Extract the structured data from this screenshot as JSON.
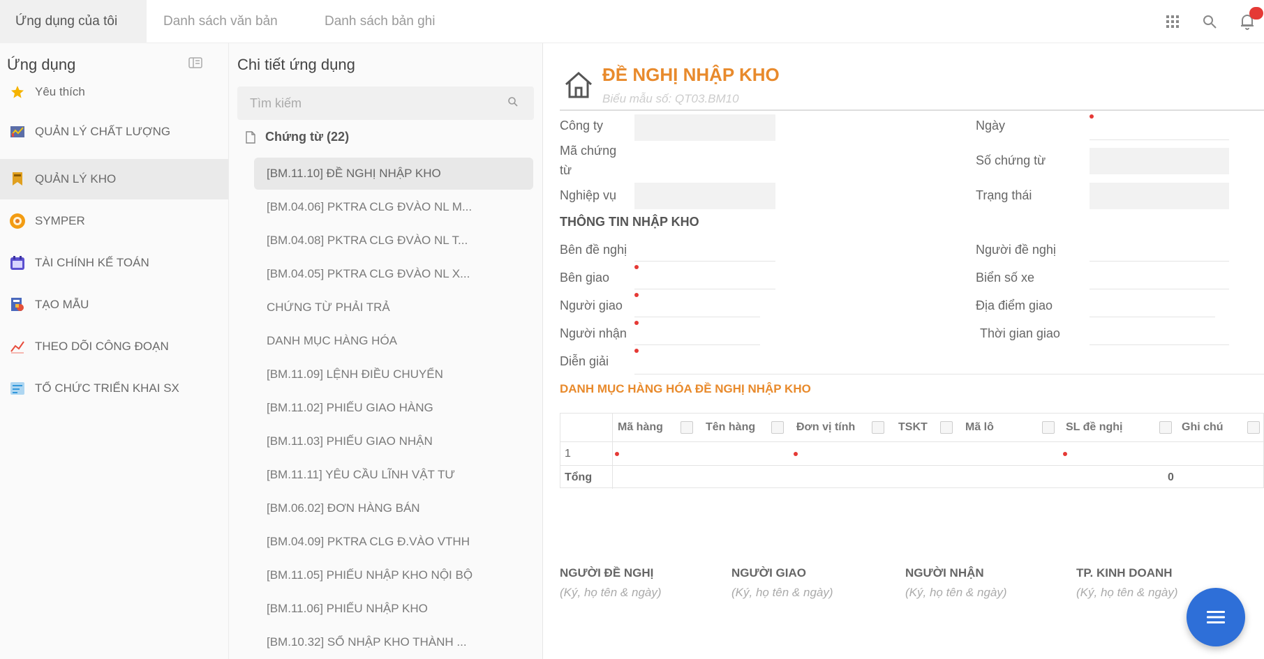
{
  "topbar": {
    "tabs": [
      {
        "label": "Ứng dụng của tôi",
        "active": true
      },
      {
        "label": "Danh sách văn bản",
        "active": false
      },
      {
        "label": "Danh sách bản ghi",
        "active": false
      }
    ],
    "icons": [
      "apps-grid-icon",
      "search-icon",
      "bell-icon"
    ]
  },
  "sidebar": {
    "title": "Ứng dụng",
    "items": [
      {
        "label": "Yêu thích",
        "icon": "star-icon",
        "color": "#f5b301"
      },
      {
        "label": "QUẢN LÝ CHẤT LƯỢNG",
        "icon": "chart-icon",
        "color": "#c0392b"
      },
      {
        "label": "QUẢN LÝ KHO",
        "icon": "warehouse-icon",
        "color": "#e0a020",
        "active": true
      },
      {
        "label": "SYMPER",
        "icon": "symper-icon",
        "color": "#f39c12"
      },
      {
        "label": "TÀI CHÍNH KẾ TOÁN",
        "icon": "calendar-icon",
        "color": "#5a4fcf"
      },
      {
        "label": "TẠO MẪU",
        "icon": "template-icon",
        "color": "#8e44ad"
      },
      {
        "label": "THEO DÕI CÔNG ĐOẠN",
        "icon": "line-chart-icon",
        "color": "#e74c3c"
      },
      {
        "label": "TỔ CHỨC TRIỂN KHAI SX",
        "icon": "tasks-icon",
        "color": "#3498db"
      }
    ]
  },
  "middle": {
    "title": "Chi tiết ứng dụng",
    "search_placeholder": "Tìm kiếm",
    "folder_label": "Chứng từ (22)",
    "items": [
      "[BM.11.10] ĐỀ NGHỊ NHẬP KHO",
      "[BM.04.06] PKTRA CLG ĐVÀO NL M...",
      "[BM.04.08] PKTRA CLG ĐVÀO NL T...",
      "[BM.04.05] PKTRA CLG ĐVÀO NL X...",
      "CHỨNG TỪ PHẢI TRẢ",
      "DANH MỤC HÀNG HÓA",
      "[BM.11.09] LỆNH ĐIỀU CHUYỂN",
      "[BM.11.02] PHIẾU GIAO HÀNG",
      "[BM.11.03] PHIẾU GIAO NHẬN",
      "[BM.11.11] YÊU CẦU LĨNH VẬT TƯ",
      "[BM.06.02] ĐƠN HÀNG BÁN",
      "[BM.04.09] PKTRA CLG Đ.VÀO VTHH",
      "[BM.11.05] PHIẾU NHẬP KHO NỘI BỘ",
      "[BM.11.06] PHIẾU NHẬP KHO",
      "[BM.10.32] SỔ NHẬP KHO THÀNH ..."
    ]
  },
  "form": {
    "title": "ĐỀ NGHỊ NHẬP KHO",
    "subtitle": "Biểu mẫu số: QT03.BM10",
    "labels": {
      "cong_ty": "Công ty",
      "ma_chung_tu_1": "Mã chứng",
      "ma_chung_tu_2": "từ",
      "nghiep_vu": "Nghiệp vụ",
      "ngay": "Ngày",
      "so_chung_tu": "Số chứng từ",
      "trang_thai": "Trạng thái",
      "section_info": "THÔNG TIN  NHẬP KHO",
      "ben_de_nghi": "Bên đề nghị",
      "ben_giao": "Bên giao",
      "nguoi_giao": "Người giao",
      "nguoi_nhan": "Người nhận",
      "dien_giai": "Diễn giải",
      "nguoi_de_nghi": "Người đề nghị",
      "bien_so_xe": "Biển số xe",
      "dia_diem_giao": "Địa điểm giao",
      "thoi_gian_giao": "Thời gian giao",
      "section_goods": "DANH MỤC HÀNG HÓA ĐỀ NGHỊ NHẬP KHO"
    },
    "table": {
      "columns": [
        "Mã hàng",
        "Tên hàng",
        "Đơn vị tính",
        "TSKT",
        "Mã lô",
        "SL đề nghị",
        "Ghi chú"
      ],
      "row_number": "1",
      "total_label": "Tổng",
      "total_value": "0"
    },
    "signatures": [
      {
        "title": "NGƯỜI ĐỀ NGHỊ",
        "sub": "(Ký, họ tên & ngày)"
      },
      {
        "title": "NGƯỜI GIAO",
        "sub": "(Ký, họ tên & ngày)"
      },
      {
        "title": "NGƯỜI NHẬN",
        "sub": "(Ký, họ tên & ngày)"
      },
      {
        "title": "TP. KINH DOANH",
        "sub": "(Ký, họ tên & ngày)"
      }
    ]
  },
  "colors": {
    "accent_orange": "#e88a2c",
    "fab_blue": "#2e6fd8",
    "required_red": "#e53935"
  }
}
